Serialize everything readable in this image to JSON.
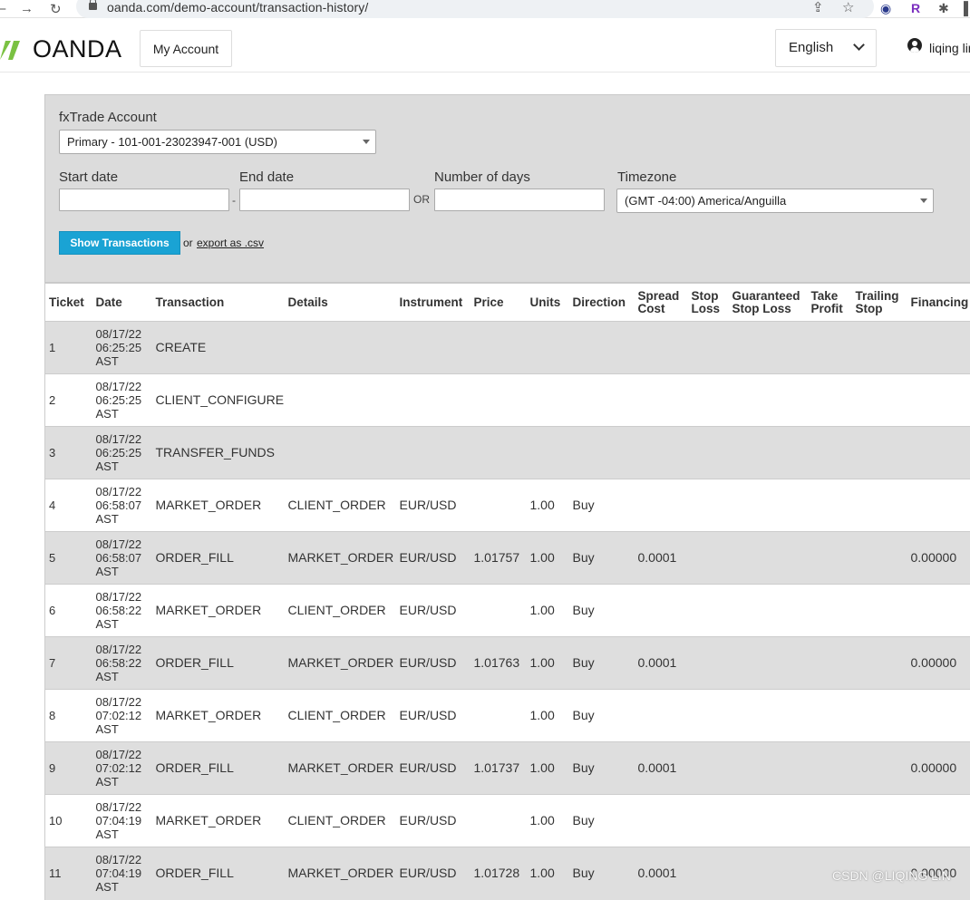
{
  "browser": {
    "url": "oanda.com/demo-account/transaction-history/"
  },
  "header": {
    "logo_text": "OANDA",
    "my_account_label": "My Account",
    "language": "English",
    "user_name": "liqing lin"
  },
  "colors": {
    "accent": "#1aa3d4",
    "logo_green": "#7ac142",
    "panel_bg": "#dcdcdc",
    "row_alt_bg": "#dedede"
  },
  "filters": {
    "account_label": "fxTrade Account",
    "account_value": "Primary - 101-001-23023947-001 (USD)",
    "start_date_label": "Start date",
    "start_date_value": "",
    "end_date_label": "End date",
    "end_date_value": "",
    "date_separator": "-",
    "or_label": "OR",
    "days_label": "Number of days",
    "days_value": "",
    "timezone_label": "Timezone",
    "timezone_value": "(GMT -04:00) America/Anguilla",
    "show_button": "Show Transactions",
    "or_text": "or",
    "export_link": "export as .csv"
  },
  "table": {
    "columns": [
      "Ticket",
      "Date",
      "Transaction",
      "Details",
      "Instrument",
      "Price",
      "Units",
      "Direction",
      "Spread Cost",
      "Stop Loss",
      "Guaranteed Stop Loss",
      "Take Profit",
      "Trailing Stop",
      "Financing"
    ],
    "rows": [
      [
        "1",
        "08/17/22 06:25:25 AST",
        "CREATE",
        "",
        "",
        "",
        "",
        "",
        "",
        "",
        "",
        "",
        "",
        ""
      ],
      [
        "2",
        "08/17/22 06:25:25 AST",
        "CLIENT_CONFIGURE",
        "",
        "",
        "",
        "",
        "",
        "",
        "",
        "",
        "",
        "",
        ""
      ],
      [
        "3",
        "08/17/22 06:25:25 AST",
        "TRANSFER_FUNDS",
        "",
        "",
        "",
        "",
        "",
        "",
        "",
        "",
        "",
        "",
        ""
      ],
      [
        "4",
        "08/17/22 06:58:07 AST",
        "MARKET_ORDER",
        "CLIENT_ORDER",
        "EUR/USD",
        "",
        "1.00",
        "Buy",
        "",
        "",
        "",
        "",
        "",
        ""
      ],
      [
        "5",
        "08/17/22 06:58:07 AST",
        "ORDER_FILL",
        "MARKET_ORDER",
        "EUR/USD",
        "1.01757",
        "1.00",
        "Buy",
        "0.0001",
        "",
        "",
        "",
        "",
        "0.00000"
      ],
      [
        "6",
        "08/17/22 06:58:22 AST",
        "MARKET_ORDER",
        "CLIENT_ORDER",
        "EUR/USD",
        "",
        "1.00",
        "Buy",
        "",
        "",
        "",
        "",
        "",
        ""
      ],
      [
        "7",
        "08/17/22 06:58:22 AST",
        "ORDER_FILL",
        "MARKET_ORDER",
        "EUR/USD",
        "1.01763",
        "1.00",
        "Buy",
        "0.0001",
        "",
        "",
        "",
        "",
        "0.00000"
      ],
      [
        "8",
        "08/17/22 07:02:12 AST",
        "MARKET_ORDER",
        "CLIENT_ORDER",
        "EUR/USD",
        "",
        "1.00",
        "Buy",
        "",
        "",
        "",
        "",
        "",
        ""
      ],
      [
        "9",
        "08/17/22 07:02:12 AST",
        "ORDER_FILL",
        "MARKET_ORDER",
        "EUR/USD",
        "1.01737",
        "1.00",
        "Buy",
        "0.0001",
        "",
        "",
        "",
        "",
        "0.00000"
      ],
      [
        "10",
        "08/17/22 07:04:19 AST",
        "MARKET_ORDER",
        "CLIENT_ORDER",
        "EUR/USD",
        "",
        "1.00",
        "Buy",
        "",
        "",
        "",
        "",
        "",
        ""
      ],
      [
        "11",
        "08/17/22 07:04:19 AST",
        "ORDER_FILL",
        "MARKET_ORDER",
        "EUR/USD",
        "1.01728",
        "1.00",
        "Buy",
        "0.0001",
        "",
        "",
        "",
        "",
        "0.00000"
      ]
    ]
  },
  "watermark": "CSDN @LIQING LIN"
}
